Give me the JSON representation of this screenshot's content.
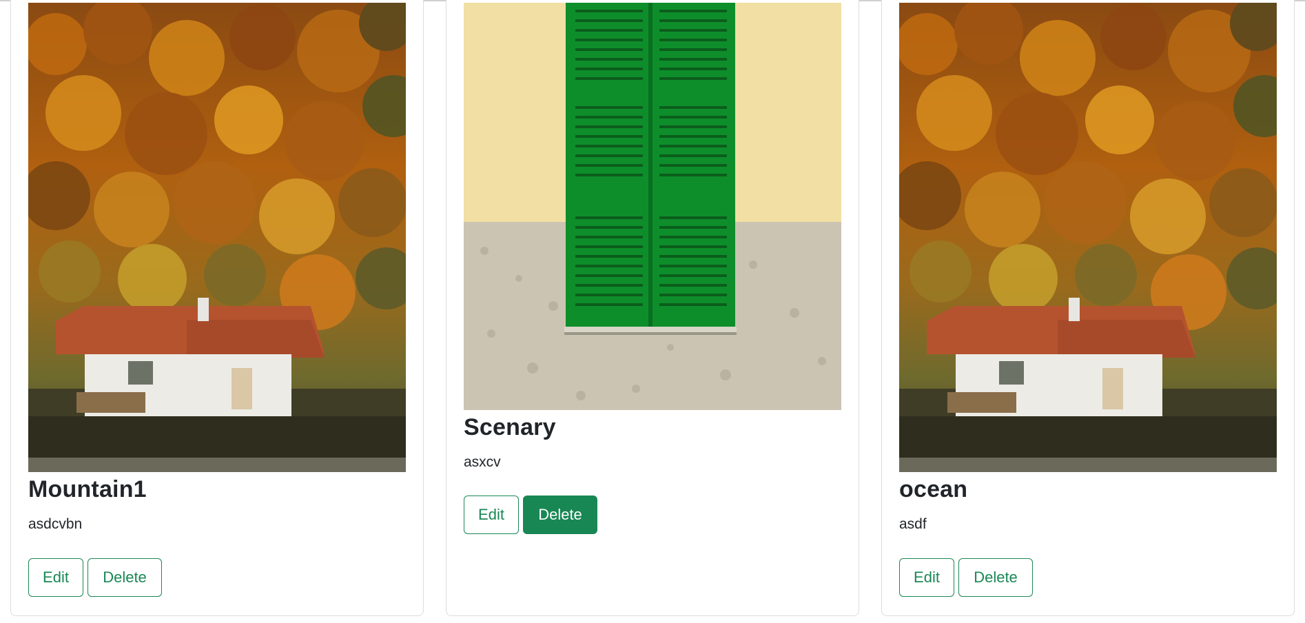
{
  "cards": [
    {
      "title": "Mountain1",
      "text": "asdcvbn",
      "image": "autumn-forest-cottage",
      "edit_label": "Edit",
      "delete_label": "Delete",
      "delete_style": "outline"
    },
    {
      "title": "Scenary",
      "text": "asxcv",
      "image": "green-shutters-wall",
      "edit_label": "Edit",
      "delete_label": "Delete",
      "delete_style": "solid"
    },
    {
      "title": "ocean",
      "text": "asdf",
      "image": "autumn-forest-cottage",
      "edit_label": "Edit",
      "delete_label": "Delete",
      "delete_style": "outline"
    }
  ],
  "colors": {
    "accent": "#198754",
    "border": "#dcdcdc",
    "text": "#212529"
  }
}
